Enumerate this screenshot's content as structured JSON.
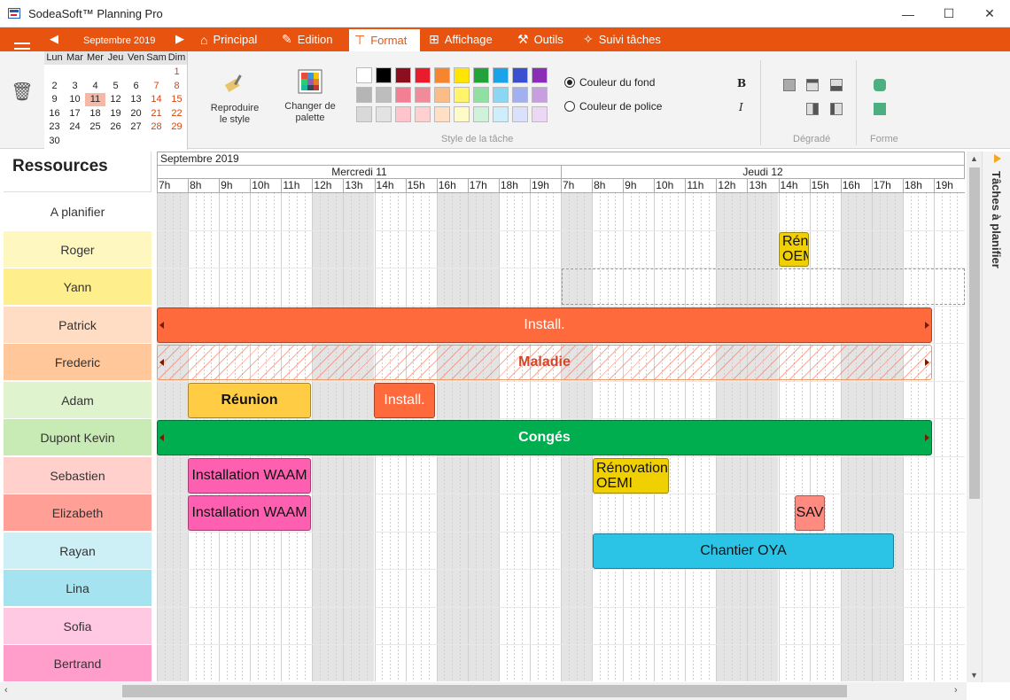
{
  "window": {
    "title": "SodeaSoft™ Planning Pro",
    "minimize": "—",
    "maximize": "☐",
    "close": "✕"
  },
  "nav": {
    "month_label": "Septembre 2019",
    "prev": "◀",
    "next": "▶"
  },
  "tabs": [
    {
      "label": "Principal",
      "icon": "home-icon"
    },
    {
      "label": "Edition",
      "icon": "edit-icon"
    },
    {
      "label": "Format",
      "icon": "paint-roller-icon",
      "active": true
    },
    {
      "label": "Affichage",
      "icon": "grid-icon"
    },
    {
      "label": "Outils",
      "icon": "tools-icon"
    },
    {
      "label": "Suivi tâches",
      "icon": "pin-icon"
    }
  ],
  "calendar": {
    "day_headers": [
      "Lun",
      "Mar",
      "Mer",
      "Jeu",
      "Ven",
      "Sam",
      "Dim"
    ],
    "rows": [
      [
        "",
        "",
        "",
        "",
        "",
        "",
        "1"
      ],
      [
        "2",
        "3",
        "4",
        "5",
        "6",
        "7",
        "8"
      ],
      [
        "9",
        "10",
        "11",
        "12",
        "13",
        "14",
        "15"
      ],
      [
        "16",
        "17",
        "18",
        "19",
        "20",
        "21",
        "22"
      ],
      [
        "23",
        "24",
        "25",
        "26",
        "27",
        "28",
        "29"
      ],
      [
        "30",
        "",
        "",
        "",
        "",
        "",
        ""
      ]
    ],
    "selected_day": "11",
    "weekend_color": "#d4460c"
  },
  "ribbon": {
    "reproduce_label": "Reproduire le style",
    "palette_label": "Changer de palette",
    "style_group_label": "Style de la tâche",
    "bg_color_label": "Couleur du fond",
    "font_color_label": "Couleur de police",
    "bold_label": "B",
    "italic_label": "I",
    "gradient_group_label": "Dégradé",
    "shape_group_label": "Forme",
    "swatches": [
      [
        "#ffffff",
        "#000000",
        "#8b0f1f",
        "#e81c2c",
        "#f7852e",
        "#ffe600",
        "#22a33a",
        "#1aa3e6",
        "#3a4fcf",
        "#8a2fb5"
      ],
      [
        "#b5b5b5",
        "#bdbdbd",
        "#f47f94",
        "#f08c9a",
        "#fbbd86",
        "#fff46a",
        "#8fe0a2",
        "#8bd6f2",
        "#a3b0ef",
        "#c79fe0"
      ],
      [
        "#d9d9d9",
        "#e3e3e3",
        "#ffc4cc",
        "#ffd0d0",
        "#ffe0c7",
        "#fffbc8",
        "#d1f2da",
        "#cdeefa",
        "#dbe1fa",
        "#ecd7f5"
      ]
    ]
  },
  "grid": {
    "month": "Septembre 2019",
    "days": [
      "Mercredi 11",
      "Jeudi 12"
    ],
    "hours": [
      "7h",
      "8h",
      "9h",
      "10h",
      "11h",
      "12h",
      "13h",
      "14h",
      "15h",
      "16h",
      "17h",
      "18h",
      "19h"
    ]
  },
  "resources_title": "Ressources",
  "resources": [
    {
      "name": "A planifier",
      "color": "#ffffff"
    },
    {
      "name": "Roger",
      "color": "#fff7c0"
    },
    {
      "name": "Yann",
      "color": "#ffee8c"
    },
    {
      "name": "Patrick",
      "color": "#ffdcc4"
    },
    {
      "name": "Frederic",
      "color": "#ffc79a"
    },
    {
      "name": "Adam",
      "color": "#dff3cf"
    },
    {
      "name": "Dupont Kevin",
      "color": "#c8eab5"
    },
    {
      "name": "Sebastien",
      "color": "#ffd0cc"
    },
    {
      "name": "Elizabeth",
      "color": "#ff9f96"
    },
    {
      "name": "Rayan",
      "color": "#cdeff6"
    },
    {
      "name": "Lina",
      "color": "#a6e3f0"
    },
    {
      "name": "Sofia",
      "color": "#ffc9e3"
    },
    {
      "name": "Bertrand",
      "color": "#ff9dcb"
    }
  ],
  "tasks": [
    {
      "label": "Rénovation OEMI",
      "resource": "Roger",
      "color": "#f0d000"
    },
    {
      "label": "Install.",
      "resource": "Patrick",
      "color": "#ff6a3d"
    },
    {
      "label": "Maladie",
      "resource": "Frederic",
      "color": "#ffd8c8"
    },
    {
      "label": "Réunion",
      "resource": "Adam",
      "color": "#ffcc44"
    },
    {
      "label": "Install.",
      "resource": "Adam",
      "color": "#ff6a3d"
    },
    {
      "label": "Congés",
      "resource": "Dupont Kevin",
      "color": "#00ad4f"
    },
    {
      "label": "Installation WAAM",
      "resource": "Sebastien",
      "color": "#ff5fb0"
    },
    {
      "label": "Rénovation OEMI",
      "resource": "Sebastien",
      "color": "#f0d000"
    },
    {
      "label": "Installation WAAM",
      "resource": "Elizabeth",
      "color": "#ff5fb0"
    },
    {
      "label": "SAV",
      "resource": "Elizabeth",
      "color": "#ff8a80"
    },
    {
      "label": "Chantier OYA",
      "resource": "Rayan",
      "color": "#2cc4e6"
    }
  ],
  "side_panel_label": "Tâches à planifier"
}
